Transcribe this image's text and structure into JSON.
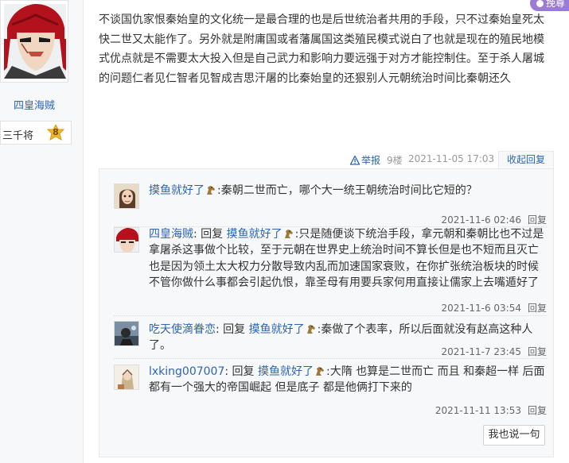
{
  "author": {
    "name": "四皇海贼",
    "rank_title": "三千将",
    "rank_level": "8"
  },
  "badge": {
    "label": "挽尊"
  },
  "post": {
    "content": "不谈国仇家恨秦始皇的文化统一是最合理的也是后世统治者共用的手段，只不过秦始皇死太快二世又太能作了。另外就是附庸国或者藩属国这类殖民模式说白了也就是现在的殖民地模式优点就是不需要太大投入但是自己武力和影响力要远强于对方才能控制住。至于杀人屠城的问题仁者见仁智者见智成吉思汗屠的比秦始皇的还狠别人元朝统治时间比秦朝还久",
    "report_label": "举报",
    "floor": "9楼",
    "time": "2021-11-05 17:03",
    "collapse_label": "收起回复"
  },
  "replies": [
    {
      "user": "摸鱼就好了",
      "sep": ":",
      "text": "秦朝二世而亡，哪个大一统王朝统治时间比它短的？",
      "time": "2021-11-6 02:46",
      "reply_label": "回复"
    },
    {
      "user": "四皇海贼",
      "reply_word": "回复",
      "target": "摸鱼就好了",
      "sep": ":",
      "text": "只是随便谈下统治手段，拿元朝和秦朝比也不过是拿屠杀这事做个比较，至于元朝在世界史上统治时间不算长但是也不短而且灭亡也是因为领土太大权力分散导致内乱而加速国家衰败，在你扩张统治板块的时候不管你做什么事都会引起仇恨，靠圣母有用要兵家何用直接让儒家上去嘴遁好了",
      "time": "2021-11-6 03:54",
      "reply_label": "回复"
    },
    {
      "user": "吃天使滴眷恋",
      "sep_user": ":",
      "reply_word": "回复",
      "target": "摸鱼就好了",
      "sep": ":",
      "text": "秦做了个表率，所以后面就没有赵高这种人了。",
      "time": "2021-11-7 23:45",
      "reply_label": "回复"
    },
    {
      "user": "lxking007007",
      "sep_user": ":",
      "reply_word": "回复",
      "target": "摸鱼就好了",
      "sep": ":",
      "text": "大隋 也算是二世而亡 而且 和秦超一样 后面都有一个强大的帝国崛起 但是底子 都是他俩打下来的",
      "time": "2021-11-11 13:53",
      "reply_label": "回复"
    }
  ],
  "say_button": "我也说一句"
}
